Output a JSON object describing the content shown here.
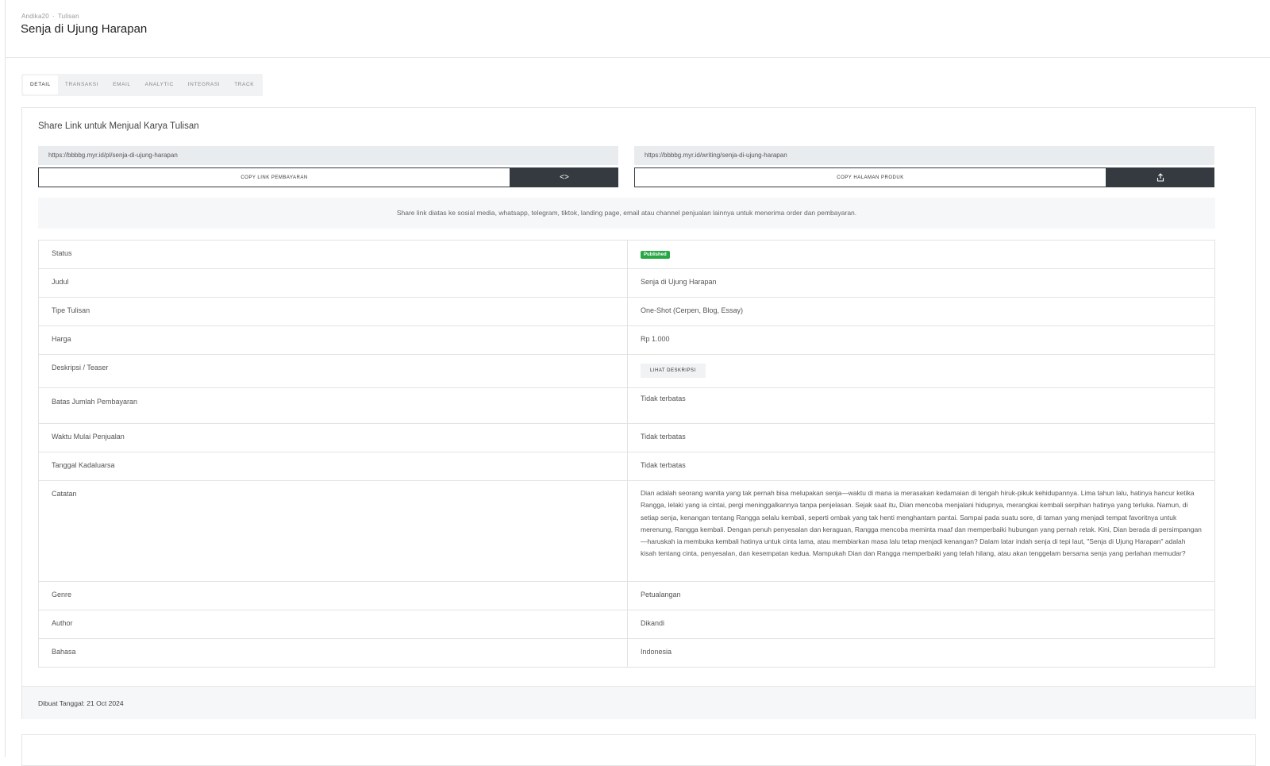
{
  "header": {
    "breadcrumb": [
      "Andika20",
      "Tulisan"
    ],
    "title": "Senja di Ujung Harapan"
  },
  "tabs": [
    {
      "label": "DETAIL",
      "active": true
    },
    {
      "label": "TRANSAKSI",
      "active": false
    },
    {
      "label": "EMAIL",
      "active": false
    },
    {
      "label": "ANALYTIC",
      "active": false
    },
    {
      "label": "INTEGRASI",
      "active": false
    },
    {
      "label": "TRACK",
      "active": false
    }
  ],
  "share": {
    "title": "Share Link untuk Menjual Karya Tulisan",
    "payment_url": "https://bbbbg.myr.id/pl/senja-di-ujung-harapan",
    "product_url": "https://bbbbg.myr.id/writing/senja-di-ujung-harapan",
    "copy_payment_label": "COPY LINK PEMBAYARAN",
    "copy_product_label": "COPY HALAMAN PRODUK",
    "embed_icon": "code-icon",
    "share_icon": "share-icon",
    "info": "Share link diatas ke sosial media, whatsapp, telegram, tiktok, landing page, email atau channel penjualan lainnya untuk menerima order dan pembayaran."
  },
  "details": {
    "status_label": "Status",
    "status_value": "Published",
    "status_color": "#28a745",
    "judul_label": "Judul",
    "judul_value": "Senja di Ujung Harapan",
    "tipe_label": "Tipe Tulisan",
    "tipe_value": "One-Shot (Cerpen, Blog, Essay)",
    "harga_label": "Harga",
    "harga_value": "Rp 1.000",
    "deskripsi_label": "Deskripsi / Teaser",
    "deskripsi_button": "LIHAT DESKRIPSI",
    "batas_label": "Batas Jumlah Pembayaran",
    "batas_value": "Tidak terbatas",
    "waktu_label": "Waktu Mulai Penjualan",
    "waktu_value": "Tidak terbatas",
    "kadaluarsa_label": "Tanggal Kadaluarsa",
    "kadaluarsa_value": "Tidak terbatas",
    "catatan_label": "Catatan",
    "catatan_value": "Dian adalah seorang wanita yang tak pernah bisa melupakan senja—waktu di mana ia merasakan kedamaian di tengah hiruk-pikuk kehidupannya. Lima tahun lalu, hatinya hancur ketika Rangga, lelaki yang ia cintai, pergi meninggalkannya tanpa penjelasan. Sejak saat itu, Dian mencoba menjalani hidupnya, merangkai kembali serpihan hatinya yang terluka. Namun, di setiap senja, kenangan tentang Rangga selalu kembali, seperti ombak yang tak henti menghantam pantai. Sampai pada suatu sore, di taman yang menjadi tempat favoritnya untuk merenung, Rangga kembali. Dengan penuh penyesalan dan keraguan, Rangga mencoba meminta maaf dan memperbaiki hubungan yang pernah retak. Kini, Dian berada di persimpangan—haruskah ia membuka kembali hatinya untuk cinta lama, atau membiarkan masa lalu tetap menjadi kenangan? Dalam latar indah senja di tepi laut, \"Senja di Ujung Harapan\" adalah kisah tentang cinta, penyesalan, dan kesempatan kedua. Mampukah Dian dan Rangga memperbaiki yang telah hilang, atau akan tenggelam bersama senja yang perlahan memudar?",
    "genre_label": "Genre",
    "genre_value": "Petualangan",
    "author_label": "Author",
    "author_value": "Dikandi",
    "bahasa_label": "Bahasa",
    "bahasa_value": "Indonesia"
  },
  "footer": {
    "created": "Dibuat Tanggal: 21 Oct 2024"
  }
}
